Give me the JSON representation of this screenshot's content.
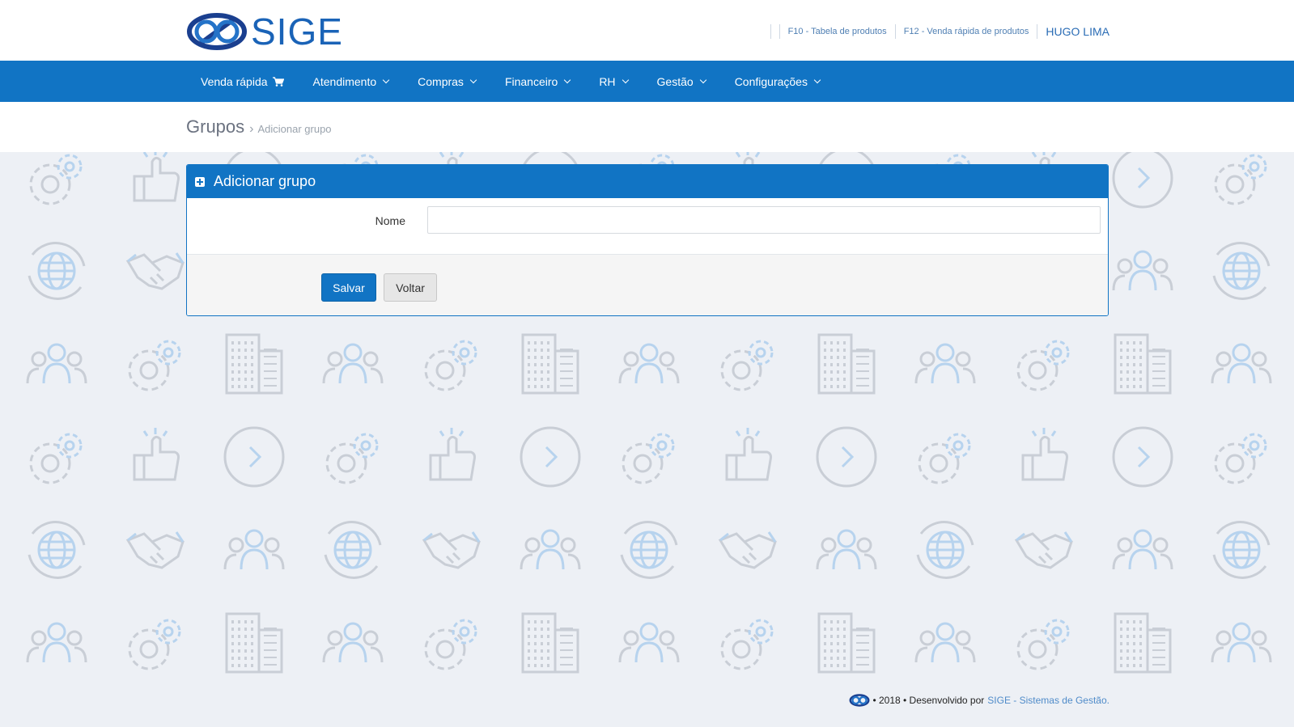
{
  "header": {
    "logo_text": "SIGE",
    "links": [
      {
        "label": "F10 - Tabela de produtos"
      },
      {
        "label": "F12 - Venda rápida de produtos"
      }
    ],
    "user_name": "HUGO LIMA"
  },
  "nav": {
    "items": [
      {
        "label": "Venda rápida",
        "icon": "cart-icon"
      },
      {
        "label": "Atendimento"
      },
      {
        "label": "Compras"
      },
      {
        "label": "Financeiro"
      },
      {
        "label": "RH"
      },
      {
        "label": "Gestão"
      },
      {
        "label": "Configurações"
      }
    ]
  },
  "breadcrumb": {
    "title": "Grupos",
    "separator": "›",
    "current": "Adicionar grupo"
  },
  "card": {
    "title": "Adicionar grupo",
    "fields": {
      "nome_label": "Nome",
      "nome_value": ""
    },
    "buttons": {
      "save": "Salvar",
      "back": "Voltar"
    }
  },
  "footer": {
    "text": "• 2018 • Desenvolvido por",
    "link": "SIGE - Sistemas de Gestão."
  },
  "colors": {
    "primary": "#1174c4",
    "background": "#edf0f5",
    "pattern_grey": "#c9ced6",
    "pattern_blue": "#b7d3ee"
  }
}
